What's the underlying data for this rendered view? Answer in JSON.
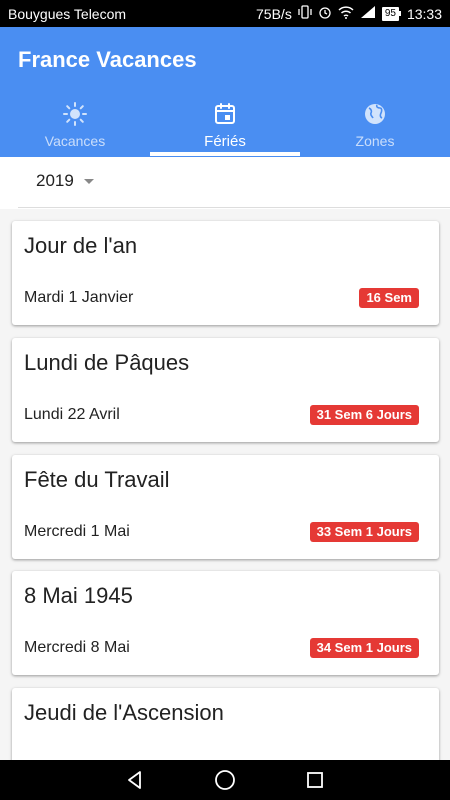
{
  "status": {
    "carrier": "Bouygues Telecom",
    "speed": "75B/s",
    "battery": "95",
    "time": "13:33"
  },
  "app": {
    "title": "France Vacances",
    "accent": "#4a8ef2"
  },
  "tabs": [
    {
      "label": "Vacances",
      "icon": "sun-icon"
    },
    {
      "label": "Fériés",
      "icon": "calendar-icon",
      "active": true
    },
    {
      "label": "Zones",
      "icon": "globe-icon"
    }
  ],
  "year": {
    "value": "2019"
  },
  "holidays": [
    {
      "name": "Jour de l'an",
      "date": "Mardi 1 Janvier",
      "badge": "16 Sem"
    },
    {
      "name": "Lundi de Pâques",
      "date": "Lundi 22 Avril",
      "badge": "31 Sem 6 Jours"
    },
    {
      "name": "Fête du Travail",
      "date": "Mercredi 1 Mai",
      "badge": "33 Sem 1 Jours"
    },
    {
      "name": "8 Mai 1945",
      "date": "Mercredi 8 Mai",
      "badge": "34 Sem 1 Jours"
    },
    {
      "name": "Jeudi de l'Ascension",
      "date": "",
      "badge": ""
    }
  ],
  "badge_color": "#e53935"
}
